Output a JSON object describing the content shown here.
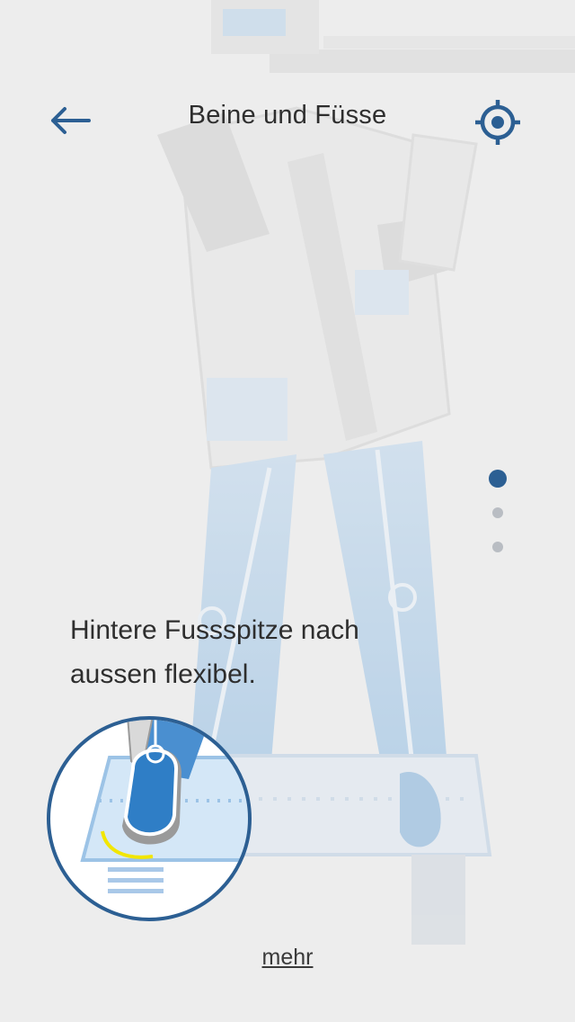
{
  "header": {
    "title": "Beine und Füsse",
    "back_icon": "arrow-left-icon",
    "action_icon": "crosshair-target-icon"
  },
  "pager": {
    "count": 3,
    "active_index": 0
  },
  "content": {
    "caption": "Hintere Fussspitze nach aussen flexibel."
  },
  "footer": {
    "more_label": "mehr"
  },
  "colors": {
    "accent": "#2c5f93",
    "background": "#ededed",
    "figure_blue": "#5b9bd5",
    "highlight_yellow": "#f2e600"
  }
}
